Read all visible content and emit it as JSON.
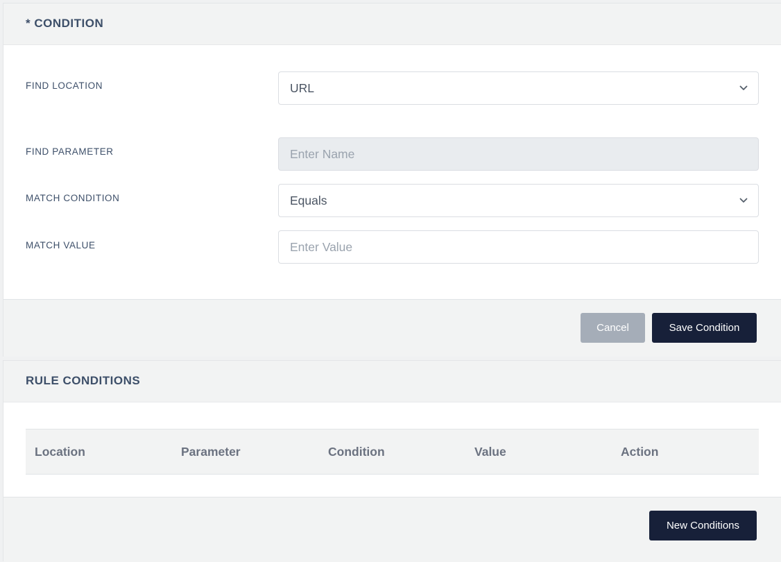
{
  "condition_card": {
    "title": "* CONDITION",
    "fields": [
      {
        "label": "FIND LOCATION",
        "type": "select",
        "value": "URL"
      },
      {
        "label": "FIND PARAMETER",
        "type": "input",
        "value": "",
        "placeholder": "Enter Name",
        "disabled": true
      },
      {
        "label": "MATCH CONDITION",
        "type": "select",
        "value": "Equals"
      },
      {
        "label": "MATCH VALUE",
        "type": "input",
        "value": "",
        "placeholder": "Enter Value"
      }
    ],
    "cancel_label": "Cancel",
    "save_label": "Save Condition"
  },
  "rules_card": {
    "title": "RULE CONDITIONS",
    "columns": [
      "Location",
      "Parameter",
      "Condition",
      "Value",
      "Action"
    ],
    "rows": [],
    "new_label": "New Conditions"
  },
  "colors": {
    "primary": "#172039",
    "cancel": "#a5adb8",
    "heading": "#3d4f69"
  },
  "icons": {
    "select_arrow": "chevron-down-icon"
  }
}
